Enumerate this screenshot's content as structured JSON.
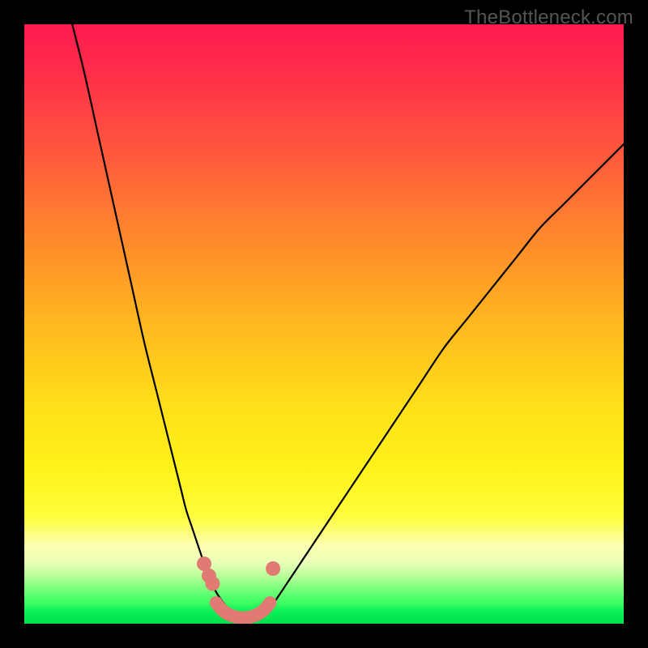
{
  "watermark": "TheBottleneck.com",
  "colors": {
    "frame": "#000000",
    "curve": "#000000",
    "marker": "#e07a72",
    "gradient_top": "#ff1a4f",
    "gradient_bottom": "#00de4d"
  },
  "chart_data": {
    "type": "line",
    "title": "",
    "xlabel": "",
    "ylabel": "",
    "xlim": [
      0,
      100
    ],
    "ylim": [
      0,
      100
    ],
    "grid": false,
    "legend": false,
    "series": [
      {
        "name": "left-curve",
        "x": [
          8,
          10,
          12,
          14,
          16,
          18,
          20,
          22,
          24,
          26,
          27,
          28,
          29,
          30,
          30.5,
          31,
          31.5,
          32,
          32.5,
          33,
          34,
          35
        ],
        "y": [
          100,
          92,
          83,
          74,
          65,
          56,
          47,
          39,
          31,
          23,
          19,
          16,
          13,
          10,
          8.5,
          7.3,
          6.3,
          5.3,
          4.5,
          3.8,
          2.5,
          1.5
        ]
      },
      {
        "name": "right-curve",
        "x": [
          40,
          41,
          42,
          44,
          46,
          48,
          50,
          54,
          58,
          62,
          66,
          70,
          74,
          78,
          82,
          86,
          90,
          94,
          98,
          100
        ],
        "y": [
          1.5,
          2.5,
          4,
          7,
          10,
          13,
          16,
          22,
          28,
          34,
          40,
          46,
          51,
          56,
          61,
          66,
          70,
          74,
          78,
          80
        ]
      },
      {
        "name": "bottom-u",
        "x": [
          32,
          33,
          34,
          35,
          36,
          37,
          38,
          39,
          40,
          41
        ],
        "y": [
          3.5,
          2.3,
          1.6,
          1.2,
          1.0,
          1.0,
          1.2,
          1.6,
          2.3,
          3.5
        ]
      }
    ],
    "markers": [
      {
        "series": "left-curve",
        "x": 30,
        "y": 10
      },
      {
        "series": "left-curve",
        "x": 30.8,
        "y": 8.0
      },
      {
        "series": "left-curve",
        "x": 31.4,
        "y": 6.7
      },
      {
        "series": "right-curve",
        "x": 41.5,
        "y": 9.2
      }
    ]
  }
}
